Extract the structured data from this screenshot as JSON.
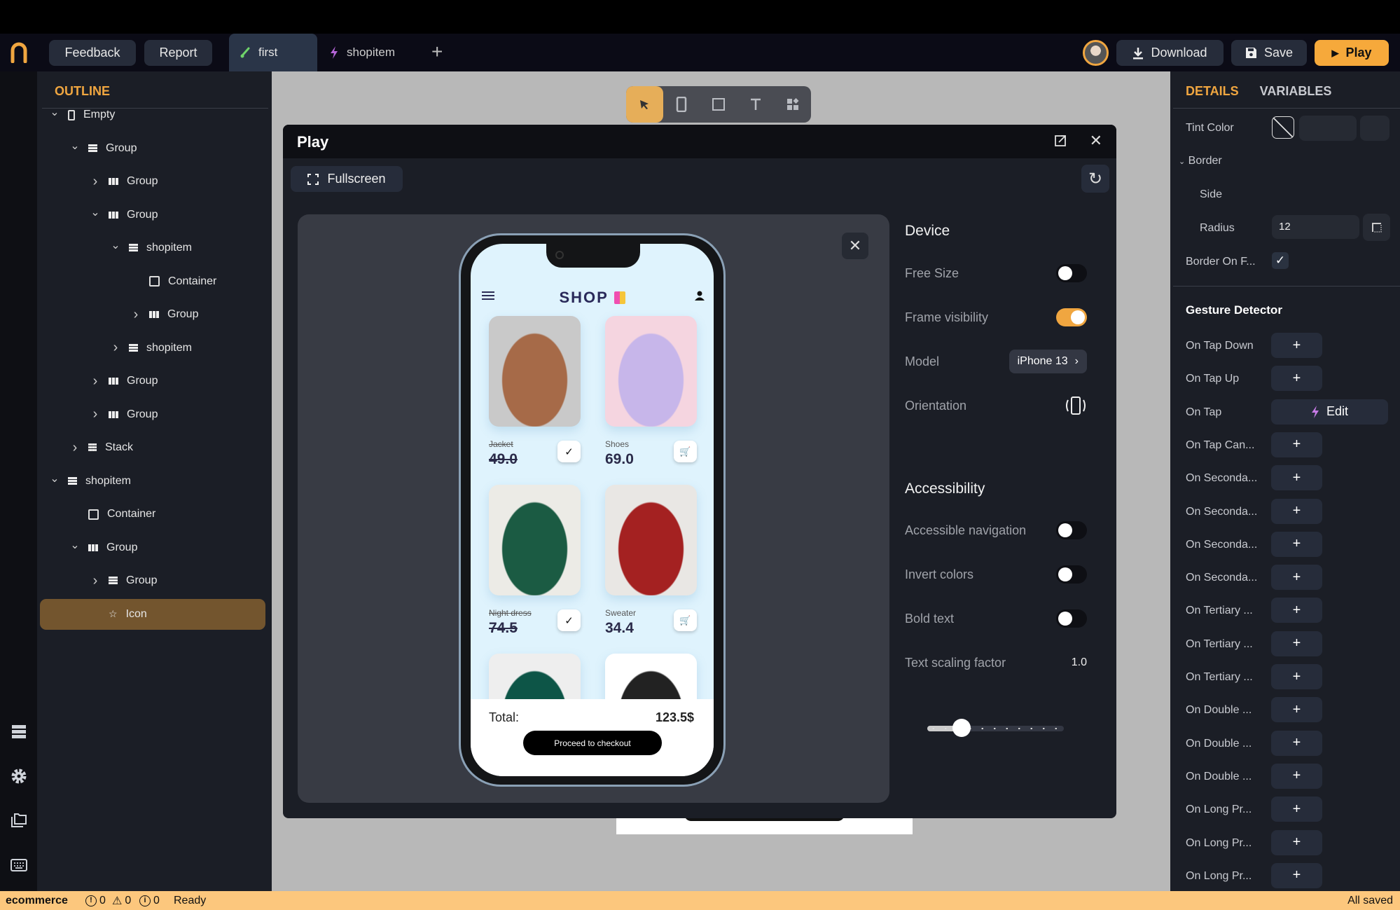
{
  "topbar": {
    "feedback": "Feedback",
    "report": "Report",
    "tabs": [
      {
        "label": "first",
        "icon": "brush-icon",
        "active": true
      },
      {
        "label": "shopitem",
        "icon": "bolt-icon",
        "active": false
      }
    ],
    "add_tab": "+",
    "download": "Download",
    "save": "Save",
    "play": "Play"
  },
  "outline": {
    "title": "OUTLINE",
    "items": [
      {
        "label": "Empty",
        "depth": 0,
        "chevron": "down",
        "icon": "phone"
      },
      {
        "label": "Group",
        "depth": 1,
        "chevron": "down",
        "icon": "row"
      },
      {
        "label": "Group",
        "depth": 2,
        "chevron": "right",
        "icon": "col"
      },
      {
        "label": "Group",
        "depth": 2,
        "chevron": "down",
        "icon": "col"
      },
      {
        "label": "shopitem",
        "depth": 3,
        "chevron": "down",
        "icon": "row"
      },
      {
        "label": "Container",
        "depth": 4,
        "chevron": "",
        "icon": "box"
      },
      {
        "label": "Group",
        "depth": 4,
        "chevron": "right",
        "icon": "col"
      },
      {
        "label": "shopitem",
        "depth": 3,
        "chevron": "right",
        "icon": "row"
      },
      {
        "label": "Group",
        "depth": 2,
        "chevron": "right",
        "icon": "col"
      },
      {
        "label": "Group",
        "depth": 2,
        "chevron": "right",
        "icon": "col"
      },
      {
        "label": "Stack",
        "depth": 1,
        "chevron": "right",
        "icon": "grid"
      },
      {
        "label": "shopitem",
        "depth": 0,
        "chevron": "down",
        "icon": "row"
      },
      {
        "label": "Container",
        "depth": 1,
        "chevron": "",
        "icon": "box"
      },
      {
        "label": "Group",
        "depth": 1,
        "chevron": "down",
        "icon": "col"
      },
      {
        "label": "Group",
        "depth": 2,
        "chevron": "right",
        "icon": "row"
      },
      {
        "label": "Icon",
        "depth": 2,
        "chevron": "",
        "icon": "star",
        "selected": true
      }
    ]
  },
  "rail": [
    "layers-icon",
    "gear-icon",
    "folders-icon",
    "keyboard-icon"
  ],
  "toolbar": [
    "pointer-icon",
    "phone-icon",
    "container-icon",
    "text-icon",
    "widgets-icon"
  ],
  "dialog": {
    "title": "Play",
    "fullscreen": "Fullscreen"
  },
  "app": {
    "title": "SHOP",
    "products": [
      {
        "name": "Jacket",
        "price": "49.0",
        "in_cart": true,
        "color": "#a66a48",
        "bg": "#c9c9c9"
      },
      {
        "name": "Shoes",
        "price": "69.0",
        "in_cart": false,
        "color": "#c7b6ea",
        "bg": "#f5d5e0"
      },
      {
        "name": "Night dress",
        "price": "74.5",
        "in_cart": true,
        "color": "#1b5b43",
        "bg": "#ecebe6"
      },
      {
        "name": "Sweater",
        "price": "34.4",
        "in_cart": false,
        "color": "#a42121",
        "bg": "#e9e7e4"
      },
      {
        "name": "",
        "price": "",
        "in_cart": false,
        "color": "#0d5547",
        "bg": "#eeeeee"
      },
      {
        "name": "",
        "price": "",
        "in_cart": false,
        "color": "#222",
        "bg": "#ffffff"
      }
    ],
    "total_label": "Total:",
    "total_value": "123.5$",
    "checkout": "Proceed to checkout"
  },
  "device": {
    "title": "Device",
    "free_size": {
      "label": "Free Size",
      "on": false
    },
    "frame_visibility": {
      "label": "Frame visibility",
      "on": true
    },
    "model_label": "Model",
    "model_value": "iPhone 13",
    "orientation": "Orientation",
    "accessibility_title": "Accessibility",
    "accessible_navigation": {
      "label": "Accessible navigation",
      "on": false
    },
    "invert_colors": {
      "label": "Invert colors",
      "on": false
    },
    "bold_text": {
      "label": "Bold text",
      "on": false
    },
    "text_scaling_label": "Text scaling factor",
    "text_scaling_value": "1.0",
    "slider_fraction": 0.25
  },
  "details": {
    "tab_details": "DETAILS",
    "tab_variables": "VARIABLES",
    "tint_color": "Tint Color",
    "border": "Border",
    "side": "Side",
    "radius": "Radius",
    "radius_value": "12",
    "border_on_focus": "Border On F...",
    "border_on_focus_checked": true,
    "gesture_title": "Gesture Detector",
    "gestures": [
      {
        "label": "On Tap Down",
        "action": "+"
      },
      {
        "label": "On Tap Up",
        "action": "+"
      },
      {
        "label": "On Tap",
        "action": "Edit"
      },
      {
        "label": "On Tap Can...",
        "action": "+"
      },
      {
        "label": "On Seconda...",
        "action": "+"
      },
      {
        "label": "On Seconda...",
        "action": "+"
      },
      {
        "label": "On Seconda...",
        "action": "+"
      },
      {
        "label": "On Seconda...",
        "action": "+"
      },
      {
        "label": "On Tertiary ...",
        "action": "+"
      },
      {
        "label": "On Tertiary ...",
        "action": "+"
      },
      {
        "label": "On Tertiary ...",
        "action": "+"
      },
      {
        "label": "On Double ...",
        "action": "+"
      },
      {
        "label": "On Double ...",
        "action": "+"
      },
      {
        "label": "On Double ...",
        "action": "+"
      },
      {
        "label": "On Long Pr...",
        "action": "+"
      },
      {
        "label": "On Long Pr...",
        "action": "+"
      },
      {
        "label": "On Long Pr...",
        "action": "+"
      }
    ]
  },
  "status": {
    "project": "ecommerce",
    "errors": "0",
    "warnings": "0",
    "infos": "0",
    "state": "Ready",
    "saved": "All saved"
  },
  "colors": {
    "accent": "#f0a640",
    "status_bar": "#fcc77d",
    "selected": "#73552e"
  }
}
